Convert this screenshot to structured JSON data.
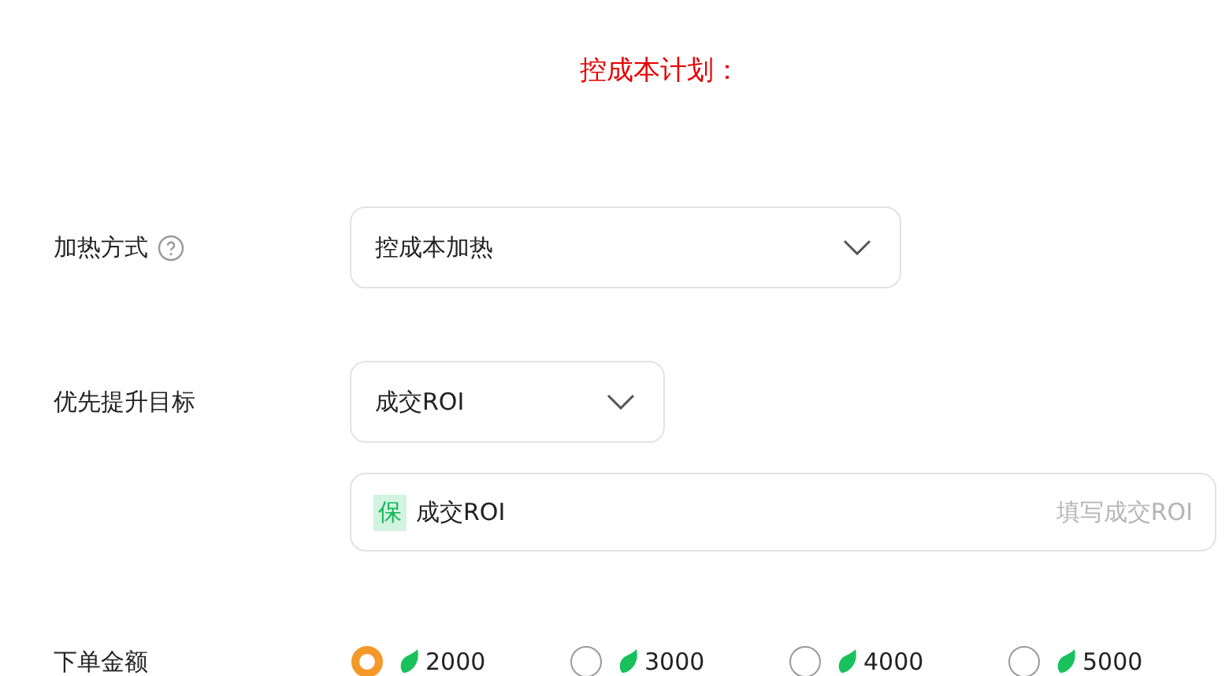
{
  "title": "控成本计划：",
  "fields": [
    {
      "kind": "select",
      "label": "加热方式",
      "help": true,
      "value": "控成本加热"
    },
    {
      "kind": "select",
      "label": "优先提升目标",
      "help": false,
      "value": "成交ROI"
    }
  ],
  "roi_input": {
    "badge": "保",
    "label": "成交ROI",
    "placeholder": "填写成交ROI"
  },
  "amount": {
    "label": "下单金额",
    "options": [
      {
        "value": "2000",
        "selected": true
      },
      {
        "value": "3000",
        "selected": false
      },
      {
        "value": "4000",
        "selected": false
      },
      {
        "value": "5000",
        "selected": false
      }
    ]
  }
}
